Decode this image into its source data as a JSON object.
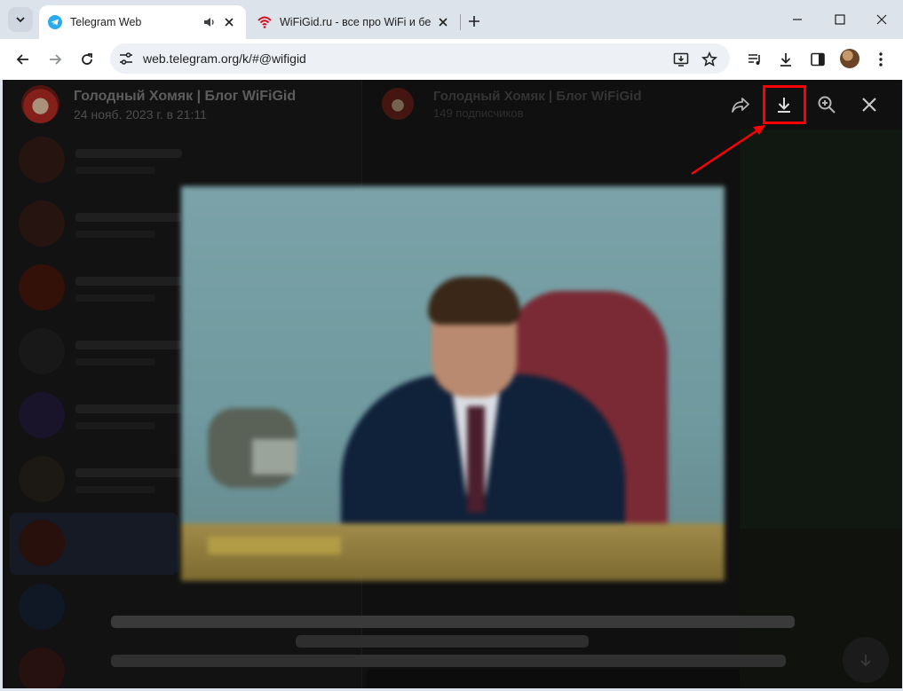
{
  "browser": {
    "tabs": [
      {
        "title": "Telegram Web",
        "active": true
      },
      {
        "title": "WiFiGid.ru - все про WiFi и бес",
        "active": false
      }
    ],
    "address_bar": {
      "url": "web.telegram.org/k/#@wifigid"
    },
    "icons": {
      "tab_search": "chevron-down-icon",
      "audio": "speaker-icon",
      "close": "close-icon",
      "new_tab": "plus-icon",
      "back": "back-arrow-icon",
      "forward": "forward-arrow-icon",
      "reload": "reload-icon",
      "site_settings": "tune-icon",
      "install": "install-app-icon",
      "bookmark": "star-icon",
      "media": "media-control-icon",
      "downloads": "download-icon",
      "side_panel": "side-panel-icon",
      "menu": "kebab-menu-icon"
    },
    "colors": {
      "chrome_bg": "#dde3ea",
      "tab_active": "#ffffff",
      "telegram_blue": "#2aabee",
      "wifi_red": "#d4111e"
    }
  },
  "media_viewer": {
    "channel_title": "Голодный Хомяк | Блог WiFiGid",
    "date": "24 нояб. 2023 г. в 21:11",
    "actions": [
      "forward",
      "download",
      "zoom",
      "close"
    ]
  },
  "background_chat": {
    "channel_title": "Голодный Хомяк | Блог WiFiGid",
    "subscribers": "149 подписчиков"
  },
  "annotation": {
    "color": "#ff0000",
    "target": "download"
  }
}
